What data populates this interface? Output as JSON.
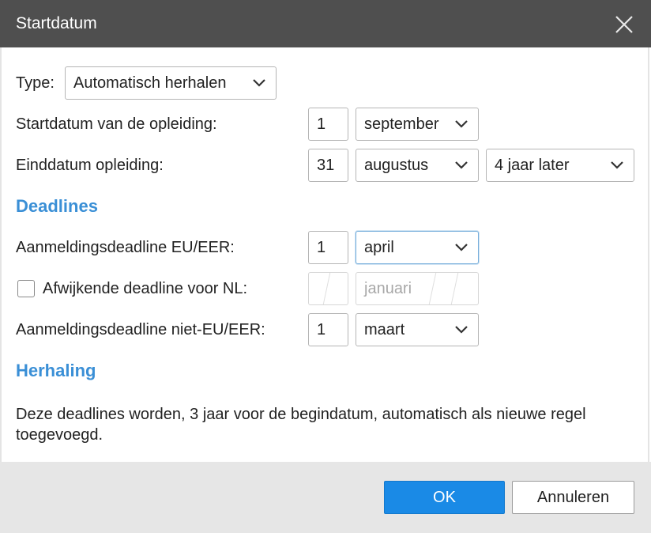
{
  "dialog": {
    "title": "Startdatum"
  },
  "type_row": {
    "label": "Type:",
    "value": "Automatisch herhalen"
  },
  "start_row": {
    "label": "Startdatum van de opleiding:",
    "day": "1",
    "month": "september"
  },
  "end_row": {
    "label": "Einddatum opleiding:",
    "day": "31",
    "month": "augustus",
    "offset": "4 jaar later"
  },
  "deadlines": {
    "heading": "Deadlines",
    "eu": {
      "label": "Aanmeldingsdeadline EU/EER:",
      "day": "1",
      "month": "april"
    },
    "nl": {
      "label": "Afwijkende deadline voor NL:",
      "checked": false,
      "day": "",
      "month_placeholder": "januari"
    },
    "non_eu": {
      "label": "Aanmeldingsdeadline niet-EU/EER:",
      "day": "1",
      "month": "maart"
    }
  },
  "repeat": {
    "heading": "Herhaling",
    "text": "Deze deadlines worden, 3 jaar voor de begindatum, automatisch als nieuwe regel toegevoegd."
  },
  "footer": {
    "ok_label": "OK",
    "cancel_label": "Annuleren"
  },
  "colors": {
    "accent": "#3a8fd6",
    "ok_button": "#1a8ae6",
    "titlebar": "#4f4f4f"
  }
}
